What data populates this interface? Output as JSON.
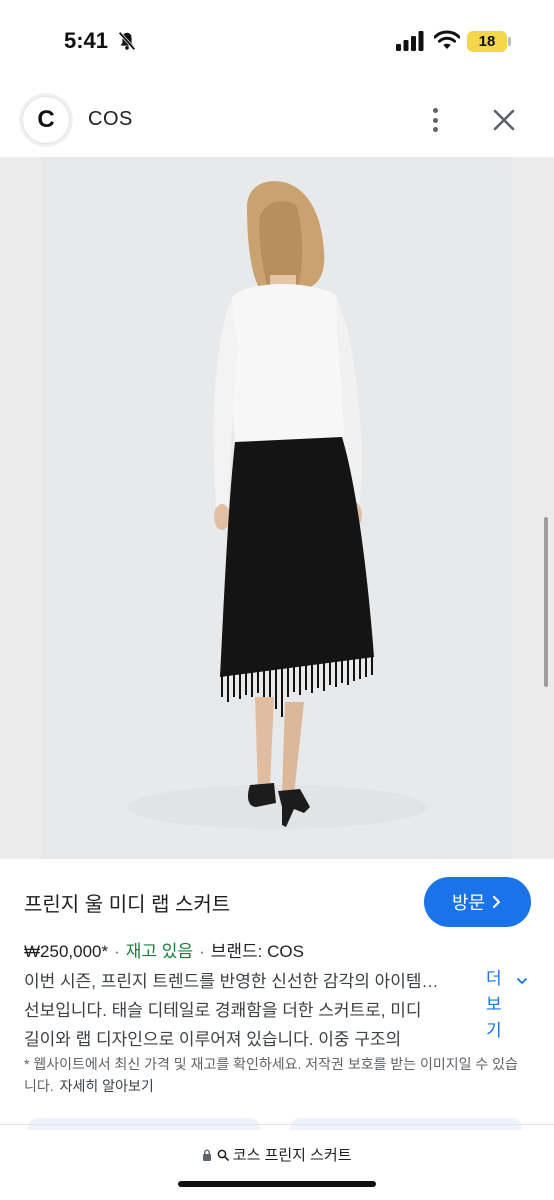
{
  "status_bar": {
    "time": "5:41",
    "battery": "18"
  },
  "source": {
    "favicon_letter": "C",
    "site_name": "COS"
  },
  "product": {
    "title": "프린지 울 미디 랩 스커트",
    "price": "₩250,000*",
    "stock": "재고 있음",
    "brand": "브랜드: COS",
    "description_lines": [
      "이번 시즌, 프린지 트렌드를 반영한 신선한 감각의 아이템…",
      "선보입니다. 태슬 디테일로 경쾌함을 더한 스커트로, 미디",
      "길이와 랩 디자인으로 이루어져 있습니다. 이중 구조의"
    ],
    "more_label": "더보기",
    "notice": "* 웹사이트에서 최신 가격 및 재고를 확인하세요. 저작권 보호를 받는 이미지일 수 있습니다.",
    "learn_more": "자세히 알아보기"
  },
  "actions": {
    "visit_label": "방문"
  },
  "address_bar": {
    "query": "코스 프린지 스커트"
  },
  "colors": {
    "accent": "#1a73e8",
    "stock_green": "#188038",
    "battery_yellow": "#f3d64a"
  },
  "icons": [
    "bell-slash-icon",
    "signal-icon",
    "wifi-icon",
    "more-vert-icon",
    "close-icon",
    "lens-icon",
    "chevron-right-icon",
    "chevron-down-icon",
    "lock-icon",
    "search-icon"
  ]
}
